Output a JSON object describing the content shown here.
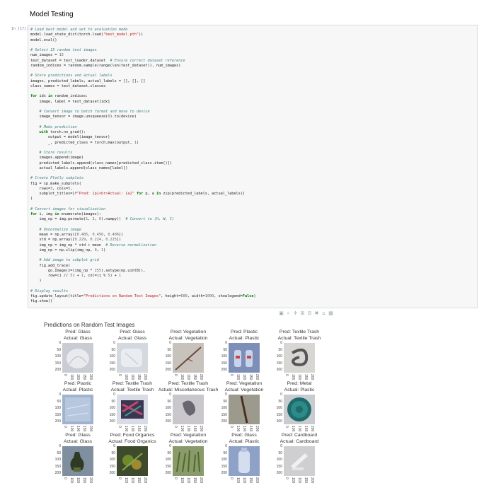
{
  "page": {
    "heading": "Model Testing",
    "prompt": "In [17]:"
  },
  "code_lines": [
    [
      [
        "cm",
        "# Load best model and set to evaluation mode"
      ]
    ],
    [
      [
        "tx",
        "model.load_state_dict(torch.load("
      ],
      [
        "st",
        "\"best_model.pth\""
      ],
      [
        "tx",
        "))"
      ]
    ],
    [
      [
        "tx",
        "model.eval()"
      ]
    ],
    [
      [
        "tx",
        ""
      ]
    ],
    [
      [
        "cm",
        "# Select 15 random test images"
      ]
    ],
    [
      [
        "tx",
        "num_images = "
      ],
      [
        "nb",
        "15"
      ]
    ],
    [
      [
        "tx",
        "test_dataset = test_loader.dataset  "
      ],
      [
        "cm",
        "# Ensure correct dataset reference"
      ]
    ],
    [
      [
        "tx",
        "random_indices = random.sample(range(len(test_dataset)), num_images)"
      ]
    ],
    [
      [
        "tx",
        ""
      ]
    ],
    [
      [
        "cm",
        "# Store predictions and actual labels"
      ]
    ],
    [
      [
        "tx",
        "images, predicted_labels, actual_labels = [], [], []"
      ]
    ],
    [
      [
        "tx",
        "class_names = test_dataset.classes"
      ]
    ],
    [
      [
        "tx",
        ""
      ]
    ],
    [
      [
        "kw",
        "for"
      ],
      [
        "tx",
        " idx "
      ],
      [
        "kw",
        "in"
      ],
      [
        "tx",
        " random_indices:"
      ]
    ],
    [
      [
        "tx",
        "    image, label = test_dataset[idx]"
      ]
    ],
    [
      [
        "tx",
        ""
      ]
    ],
    [
      [
        "tx",
        "    "
      ],
      [
        "cm",
        "# Convert image to batch format and move to device"
      ]
    ],
    [
      [
        "tx",
        "    image_tensor = image.unsqueeze("
      ],
      [
        "nb",
        "0"
      ],
      [
        "tx",
        ").to(device)"
      ]
    ],
    [
      [
        "tx",
        ""
      ]
    ],
    [
      [
        "tx",
        "    "
      ],
      [
        "cm",
        "# Make prediction"
      ]
    ],
    [
      [
        "tx",
        "    "
      ],
      [
        "kw",
        "with"
      ],
      [
        "tx",
        " torch.no_grad():"
      ]
    ],
    [
      [
        "tx",
        "        output = model(image_tensor)"
      ]
    ],
    [
      [
        "tx",
        "        _, predicted_class = torch.max(output, "
      ],
      [
        "nb",
        "1"
      ],
      [
        "tx",
        ")"
      ]
    ],
    [
      [
        "tx",
        ""
      ]
    ],
    [
      [
        "tx",
        "    "
      ],
      [
        "cm",
        "# Store results"
      ]
    ],
    [
      [
        "tx",
        "    images.append(image)"
      ]
    ],
    [
      [
        "tx",
        "    predicted_labels.append(class_names[predicted_class.item()])"
      ]
    ],
    [
      [
        "tx",
        "    actual_labels.append(class_names[label])"
      ]
    ],
    [
      [
        "tx",
        ""
      ]
    ],
    [
      [
        "cm",
        "# Create Plotly subplots"
      ]
    ],
    [
      [
        "tx",
        "fig = sp.make_subplots("
      ]
    ],
    [
      [
        "tx",
        "    rows="
      ],
      [
        "nb",
        "3"
      ],
      [
        "tx",
        ", cols="
      ],
      [
        "nb",
        "5"
      ],
      [
        "tx",
        ","
      ]
    ],
    [
      [
        "tx",
        "    subplot_titles=[f"
      ],
      [
        "st",
        "\"Pred: {p}<br>Actual: {a}\""
      ],
      [
        "tx",
        " "
      ],
      [
        "kw",
        "for"
      ],
      [
        "tx",
        " p, a "
      ],
      [
        "kw",
        "in"
      ],
      [
        "tx",
        " zip(predicted_labels, actual_labels)]"
      ]
    ],
    [
      [
        "tx",
        ")"
      ]
    ],
    [
      [
        "tx",
        ""
      ]
    ],
    [
      [
        "cm",
        "# Convert images for visualization"
      ]
    ],
    [
      [
        "kw",
        "for"
      ],
      [
        "tx",
        " i, img "
      ],
      [
        "kw",
        "in"
      ],
      [
        "tx",
        " enumerate(images):"
      ]
    ],
    [
      [
        "tx",
        "    img_np = img.permute("
      ],
      [
        "nb",
        "1"
      ],
      [
        "tx",
        ", "
      ],
      [
        "nb",
        "2"
      ],
      [
        "tx",
        ", "
      ],
      [
        "nb",
        "0"
      ],
      [
        "tx",
        ").numpy()  "
      ],
      [
        "cm",
        "# Convert to (H, W, C)"
      ]
    ],
    [
      [
        "tx",
        ""
      ]
    ],
    [
      [
        "tx",
        "    "
      ],
      [
        "cm",
        "# Unnormalize image"
      ]
    ],
    [
      [
        "tx",
        "    mean = np.array(["
      ],
      [
        "nb",
        "0.485"
      ],
      [
        "tx",
        ", "
      ],
      [
        "nb",
        "0.456"
      ],
      [
        "tx",
        ", "
      ],
      [
        "nb",
        "0.406"
      ],
      [
        "tx",
        "])"
      ]
    ],
    [
      [
        "tx",
        "    std = np.array(["
      ],
      [
        "nb",
        "0.229"
      ],
      [
        "tx",
        ", "
      ],
      [
        "nb",
        "0.224"
      ],
      [
        "tx",
        ", "
      ],
      [
        "nb",
        "0.225"
      ],
      [
        "tx",
        "])"
      ]
    ],
    [
      [
        "tx",
        "    img_np = img_np * std + mean  "
      ],
      [
        "cm",
        "# Reverse normalization"
      ]
    ],
    [
      [
        "tx",
        "    img_np = np.clip(img_np, "
      ],
      [
        "nb",
        "0"
      ],
      [
        "tx",
        ", "
      ],
      [
        "nb",
        "1"
      ],
      [
        "tx",
        ")"
      ]
    ],
    [
      [
        "tx",
        ""
      ]
    ],
    [
      [
        "tx",
        "    "
      ],
      [
        "cm",
        "# Add image to subplot grid"
      ]
    ],
    [
      [
        "tx",
        "    fig.add_trace("
      ]
    ],
    [
      [
        "tx",
        "        go.Image(z=(img_np * "
      ],
      [
        "nb",
        "255"
      ],
      [
        "tx",
        ").astype(np.uint8)),"
      ]
    ],
    [
      [
        "tx",
        "        row=(i // "
      ],
      [
        "nb",
        "5"
      ],
      [
        "tx",
        ") + "
      ],
      [
        "nb",
        "1"
      ],
      [
        "tx",
        ", col=(i % "
      ],
      [
        "nb",
        "5"
      ],
      [
        "tx",
        ") + "
      ],
      [
        "nb",
        "1"
      ]
    ],
    [
      [
        "tx",
        "    )"
      ]
    ],
    [
      [
        "tx",
        ""
      ]
    ],
    [
      [
        "cm",
        "# Display results"
      ]
    ],
    [
      [
        "tx",
        "fig.update_layout(title="
      ],
      [
        "st",
        "\"Predictions on Random Test Images\""
      ],
      [
        "tx",
        ", height="
      ],
      [
        "nb",
        "600"
      ],
      [
        "tx",
        ", width="
      ],
      [
        "nb",
        "1000"
      ],
      [
        "tx",
        ", showlegend="
      ],
      [
        "kw",
        "False"
      ],
      [
        "tx",
        ")"
      ]
    ],
    [
      [
        "tx",
        "fig.show()"
      ]
    ]
  ],
  "modebar": [
    "camera-icon",
    "zoom-icon",
    "pan-icon",
    "zoom-in-icon",
    "zoom-out-icon",
    "autoscale-icon",
    "reset-axes-icon",
    "plotly-logo-icon"
  ],
  "plot": {
    "title": "Predictions on Random Test Images",
    "y_ticks": [
      "0",
      "50",
      "100",
      "150",
      "200"
    ],
    "x_ticks": [
      "0",
      "100",
      "100",
      "150",
      "200"
    ],
    "subplots": [
      {
        "pred": "Pred: Glass",
        "actual": "Actual: Glass",
        "img": "glass-bag"
      },
      {
        "pred": "Pred: Glass",
        "actual": "Actual: Glass",
        "img": "glass-clear"
      },
      {
        "pred": "Pred: Vegetation",
        "actual": "Actual: Vegetation",
        "img": "twig"
      },
      {
        "pred": "Pred: Plastic",
        "actual": "Actual: Plastic",
        "img": "plastic-bottles"
      },
      {
        "pred": "Pred: Textile Trash",
        "actual": "Actual: Textile Trash",
        "img": "textile-knot"
      },
      {
        "pred": "Pred: Plastic",
        "actual": "Actual: Plastic",
        "img": "plastic-sheet"
      },
      {
        "pred": "Pred: Textile Trash",
        "actual": "Actual: Textile Trash",
        "img": "textile-cloth"
      },
      {
        "pred": "Pred: Textile Trash",
        "actual": "Actual: Miscellaneous Trash",
        "img": "misc-glove"
      },
      {
        "pred": "Pred: Vegetation",
        "actual": "Actual: Vegetation",
        "img": "stick"
      },
      {
        "pred": "Pred: Metal",
        "actual": "Actual: Plastic",
        "img": "teal-lid"
      },
      {
        "pred": "Pred: Glass",
        "actual": "Actual: Glass",
        "img": "glass-bottle"
      },
      {
        "pred": "Pred: Food Organics",
        "actual": "Actual: Food Organics",
        "img": "food"
      },
      {
        "pred": "Pred: Vegetation",
        "actual": "Actual: Vegetation",
        "img": "grass"
      },
      {
        "pred": "Pred: Glass",
        "actual": "Actual: Plastic",
        "img": "plastic-bottle"
      },
      {
        "pred": "Pred: Cardboard",
        "actual": "Actual: Cardboard",
        "img": "cardboard"
      }
    ]
  }
}
